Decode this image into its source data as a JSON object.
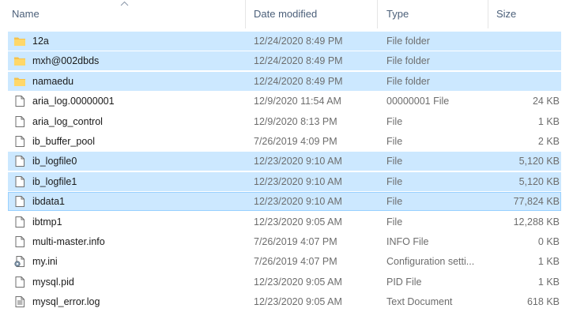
{
  "headers": {
    "name": "Name",
    "date": "Date modified",
    "type": "Type",
    "size": "Size"
  },
  "files": [
    {
      "name": "12a",
      "date": "12/24/2020 8:49 PM",
      "type": "File folder",
      "size": "",
      "icon": "folder-icon",
      "selected": true
    },
    {
      "name": "mxh@002dbds",
      "date": "12/24/2020 8:49 PM",
      "type": "File folder",
      "size": "",
      "icon": "folder-icon",
      "selected": true
    },
    {
      "name": "namaedu",
      "date": "12/24/2020 8:49 PM",
      "type": "File folder",
      "size": "",
      "icon": "folder-icon",
      "selected": true
    },
    {
      "name": "aria_log.00000001",
      "date": "12/9/2020 11:54 AM",
      "type": "00000001 File",
      "size": "24 KB",
      "icon": "file-icon",
      "selected": false
    },
    {
      "name": "aria_log_control",
      "date": "12/9/2020 8:13 PM",
      "type": "File",
      "size": "1 KB",
      "icon": "file-icon",
      "selected": false
    },
    {
      "name": "ib_buffer_pool",
      "date": "7/26/2019 4:09 PM",
      "type": "File",
      "size": "2 KB",
      "icon": "file-icon",
      "selected": false
    },
    {
      "name": "ib_logfile0",
      "date": "12/23/2020 9:10 AM",
      "type": "File",
      "size": "5,120 KB",
      "icon": "file-icon",
      "selected": true
    },
    {
      "name": "ib_logfile1",
      "date": "12/23/2020 9:10 AM",
      "type": "File",
      "size": "5,120 KB",
      "icon": "file-icon",
      "selected": true
    },
    {
      "name": "ibdata1",
      "date": "12/23/2020 9:10 AM",
      "type": "File",
      "size": "77,824 KB",
      "icon": "file-icon",
      "selected": true,
      "focused": true
    },
    {
      "name": "ibtmp1",
      "date": "12/23/2020 9:05 AM",
      "type": "File",
      "size": "12,288 KB",
      "icon": "file-icon",
      "selected": false
    },
    {
      "name": "multi-master.info",
      "date": "7/26/2019 4:07 PM",
      "type": "INFO File",
      "size": "0 KB",
      "icon": "file-icon",
      "selected": false
    },
    {
      "name": "my.ini",
      "date": "7/26/2019 4:07 PM",
      "type": "Configuration setti...",
      "size": "1 KB",
      "icon": "config-file-icon",
      "selected": false
    },
    {
      "name": "mysql.pid",
      "date": "12/23/2020 9:05 AM",
      "type": "PID File",
      "size": "1 KB",
      "icon": "file-icon",
      "selected": false
    },
    {
      "name": "mysql_error.log",
      "date": "12/23/2020 9:05 AM",
      "type": "Text Document",
      "size": "618 KB",
      "icon": "text-document-icon",
      "selected": false
    }
  ],
  "colors": {
    "selection": "#cce8ff",
    "focus_border": "#99d1ff",
    "folder": "#f4c24d",
    "header_text": "#4c607a"
  }
}
